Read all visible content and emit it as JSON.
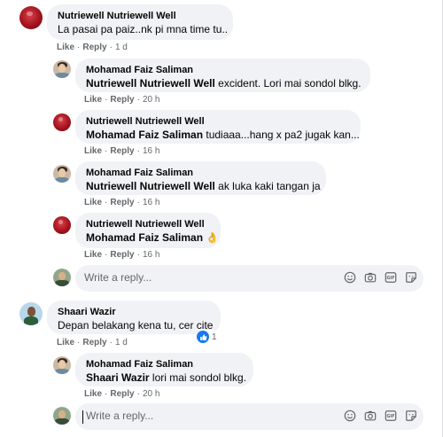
{
  "comments": [
    {
      "author": "Nutriewell Nutriewell Well",
      "text": "La pasai pa paiz..nk pi mna time tu..",
      "like": "Like",
      "reply": "Reply",
      "time": "1 d"
    },
    {
      "author": "Mohamad Faiz Saliman",
      "mention": "Nutriewell Nutriewell Well",
      "text": " excident. Lori mai sondol blkg.",
      "like": "Like",
      "reply": "Reply",
      "time": "20 h"
    },
    {
      "author": "Nutriewell Nutriewell Well",
      "mention": "Mohamad Faiz Saliman",
      "text": " tudiaaa...hang x pa2 jugak kan...",
      "like": "Like",
      "reply": "Reply",
      "time": "16 h"
    },
    {
      "author": "Mohamad Faiz Saliman",
      "mention": "Nutriewell Nutriewell Well",
      "text": " ak luka kaki tangan ja",
      "like": "Like",
      "reply": "Reply",
      "time": "16 h"
    },
    {
      "author": "Nutriewell Nutriewell Well",
      "mention": "Mohamad Faiz Saliman",
      "text": "",
      "emoji": "👌",
      "like": "Like",
      "reply": "Reply",
      "time": "16 h"
    },
    {
      "author": "Shaari Wazir",
      "text": "Depan belakang kena tu, cer cite",
      "like": "Like",
      "reply": "Reply",
      "time": "1 d",
      "reaction_count": "1"
    },
    {
      "author": "Mohamad Faiz Saliman",
      "mention": "Shaari Wazir",
      "text": " lori mai sondol blkg.",
      "like": "Like",
      "reply": "Reply",
      "time": "20 h"
    }
  ],
  "reply_placeholder": "Write a reply...",
  "icons": [
    "emoji-icon",
    "camera-icon",
    "gif-icon",
    "sticker-icon"
  ],
  "colors": {
    "bubble": "#f0f2f5",
    "meta": "#65676b",
    "like_blue": "#1877f2"
  }
}
